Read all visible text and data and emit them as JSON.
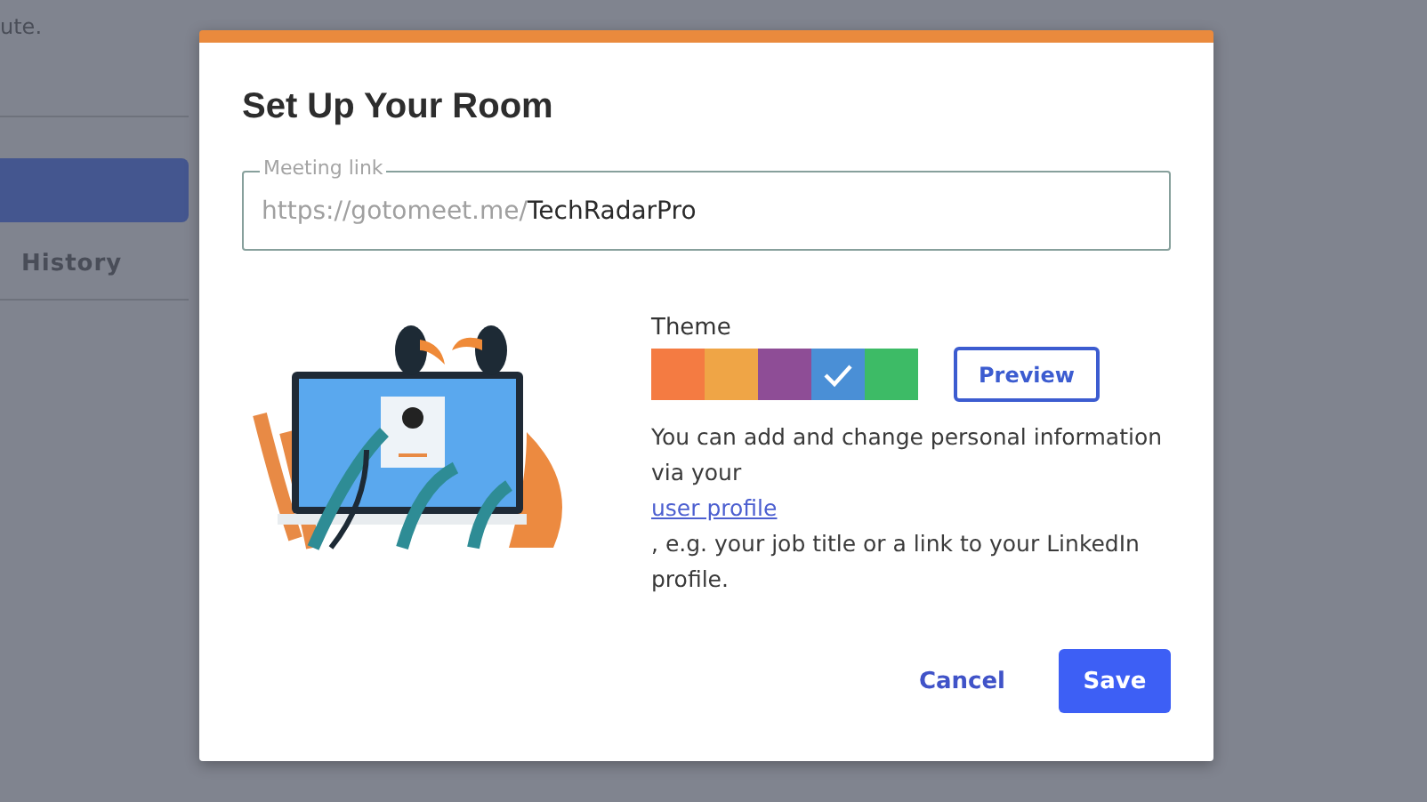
{
  "background": {
    "snippet": "ute.",
    "tab": "History"
  },
  "dialog": {
    "title": "Set Up Your Room",
    "meeting_link": {
      "label": "Meeting link",
      "prefix": "https://gotomeet.me/",
      "value": "TechRadarPro"
    },
    "theme": {
      "label": "Theme",
      "swatches": [
        {
          "color": "#f47b42",
          "selected": false
        },
        {
          "color": "#efa546",
          "selected": false
        },
        {
          "color": "#8e4d96",
          "selected": false
        },
        {
          "color": "#4a8fd6",
          "selected": true
        },
        {
          "color": "#3dbb66",
          "selected": false
        }
      ],
      "preview": "Preview"
    },
    "info": {
      "before": "You can add and change personal information via your",
      "link": "user profile",
      "after": ", e.g. your job title or a link to your LinkedIn profile."
    },
    "buttons": {
      "cancel": "Cancel",
      "save": "Save"
    }
  }
}
